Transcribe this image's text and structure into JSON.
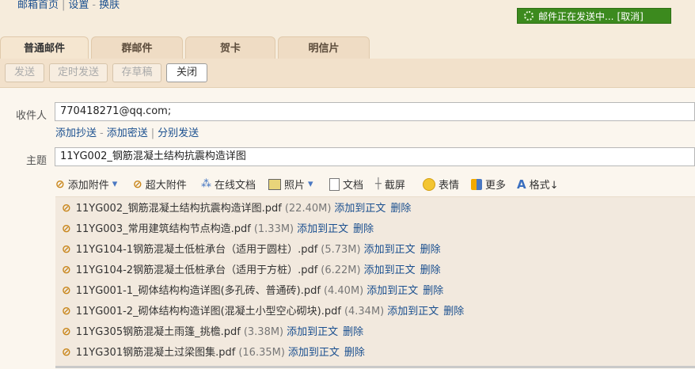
{
  "top_links": [
    "邮箱首页",
    "设置",
    "换肤"
  ],
  "sending": {
    "text": "邮件正在发送中...",
    "cancel": "[取消]"
  },
  "tabs": [
    "普通邮件",
    "群邮件",
    "贺卡",
    "明信片"
  ],
  "toolbar": {
    "send": "发送",
    "schedule": "定时发送",
    "draft": "存草稿",
    "close": "关闭"
  },
  "recipient": {
    "label": "收件人",
    "value": "770418271@qq.com;"
  },
  "recipient_links": {
    "cc": "添加抄送",
    "bcc": "添加密送",
    "separate": "分别发送"
  },
  "subject": {
    "label": "主题",
    "value": "11YG002_钢筋混凝土结构抗震构造详图"
  },
  "attach_toolbar": {
    "add_attachment": "添加附件",
    "large_attachment": "超大附件",
    "online_doc": "在线文档",
    "photo": "照片",
    "document": "文档",
    "screenshot": "截屏",
    "emoji": "表情",
    "more": "更多",
    "format": "格式↓"
  },
  "file_actions": {
    "add_to_body": "添加到正文",
    "delete": "删除"
  },
  "files": [
    {
      "name": "11YG002_钢筋混凝土结构抗震构造详图.pdf",
      "size": "(22.40M)"
    },
    {
      "name": "11YG003_常用建筑结构节点构造.pdf",
      "size": "(1.33M)"
    },
    {
      "name": "11YG104-1钢筋混凝土低桩承台（适用于圆柱）.pdf",
      "size": "(5.73M)"
    },
    {
      "name": "11YG104-2钢筋混凝土低桩承台（适用于方桩）.pdf",
      "size": "(6.22M)"
    },
    {
      "name": "11YG001-1_砌体结构构造详图(多孔砖、普通砖).pdf",
      "size": "(4.40M)"
    },
    {
      "name": "11YG001-2_砌体结构构造详图(混凝土小型空心砌块).pdf",
      "size": "(4.34M)"
    },
    {
      "name": "11YG305钢筋混凝土雨篷_挑檐.pdf",
      "size": "(3.38M)"
    },
    {
      "name": "11YG301钢筋混凝土过梁图集.pdf",
      "size": "(16.35M)"
    }
  ]
}
